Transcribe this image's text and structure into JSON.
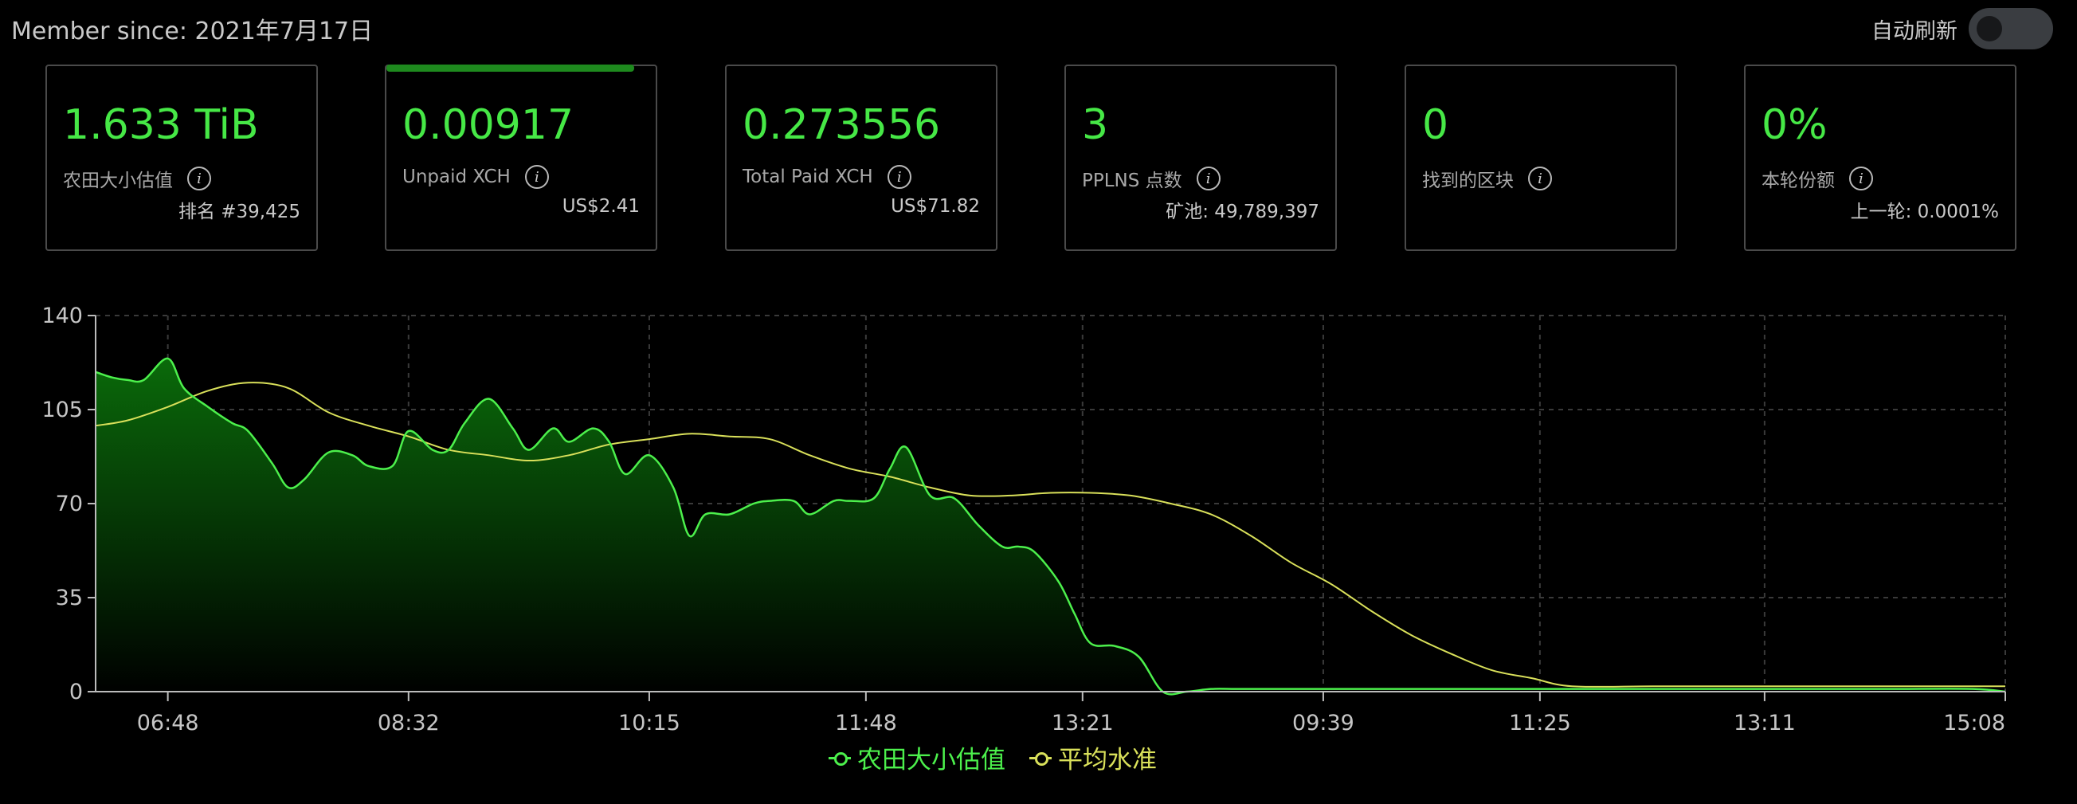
{
  "header": {
    "member_since": "Member since: 2021年7月17日",
    "auto_refresh_label": "自动刷新",
    "auto_refresh_on": false
  },
  "cards": [
    {
      "value": "1.633 TiB",
      "label": "农田大小估值",
      "sub": "排名 #39,425"
    },
    {
      "value": "0.00917",
      "label": "Unpaid XCH",
      "sub": "US$2.41",
      "progress": 0.92
    },
    {
      "value": "0.273556",
      "label": "Total Paid XCH",
      "sub": "US$71.82"
    },
    {
      "value": "3",
      "label": "PPLNS 点数",
      "sub": "矿池: 49,789,397"
    },
    {
      "value": "0",
      "label": "找到的区块",
      "sub": ""
    },
    {
      "value": "0%",
      "label": "本轮份额",
      "sub": "上一轮: 0.0001%"
    }
  ],
  "icons": {
    "info": "info-icon"
  },
  "colors": {
    "accent": "#46e846",
    "farm": "#4cf04c",
    "avg": "#d9e05a",
    "fill_top": "#0a6a0a"
  },
  "chart_data": {
    "type": "area",
    "ylim": [
      0,
      140
    ],
    "yticks": [
      0,
      35,
      70,
      105,
      140
    ],
    "xticks": [
      {
        "label": "06:48",
        "x": 0.5
      },
      {
        "label": "08:32",
        "x": 3.5
      },
      {
        "label": "10:15",
        "x": 6.5
      },
      {
        "label": "11:48",
        "x": 9.2
      },
      {
        "label": "13:21",
        "x": 11.9
      },
      {
        "label": "09:39",
        "x": 14.9
      },
      {
        "label": "11:25",
        "x": 17.6
      },
      {
        "label": "13:11",
        "x": 20.4
      },
      {
        "label": "15:08",
        "x": 23.4
      }
    ],
    "xrange": [
      -0.4,
      23.4
    ],
    "series": [
      {
        "name": "农田大小估值",
        "x": [
          -0.4,
          -0.2,
          0.0,
          0.2,
          0.5,
          0.7,
          1.0,
          1.3,
          1.5,
          1.8,
          2.0,
          2.2,
          2.5,
          2.8,
          3.0,
          3.3,
          3.5,
          3.8,
          4.0,
          4.2,
          4.5,
          4.8,
          5.0,
          5.3,
          5.5,
          5.8,
          6.0,
          6.2,
          6.5,
          6.8,
          7.0,
          7.2,
          7.5,
          7.8,
          8.0,
          8.3,
          8.5,
          8.8,
          9.0,
          9.3,
          9.5,
          9.7,
          10.0,
          10.3,
          10.6,
          10.9,
          11.1,
          11.3,
          11.6,
          11.8,
          12.0,
          12.3,
          12.6,
          12.9,
          13.2,
          13.5,
          13.8,
          14.1,
          14.4,
          14.7,
          15.0,
          15.3,
          15.6,
          16.0,
          17.0,
          18.0,
          19.0,
          20.0,
          21.0,
          22.0,
          23.0,
          23.4
        ],
        "values": [
          119,
          117,
          116,
          116,
          124,
          113,
          106,
          100,
          97,
          85,
          76,
          79,
          89,
          88,
          84,
          84,
          97,
          90,
          90,
          100,
          109,
          98,
          90,
          98,
          93,
          98,
          93,
          81,
          88,
          76,
          58,
          66,
          66,
          70,
          71,
          71,
          66,
          71,
          71,
          72,
          83,
          91,
          73,
          72,
          62,
          54,
          54,
          52,
          41,
          29,
          18,
          17,
          13,
          0,
          0,
          1,
          1,
          1,
          1,
          1,
          1,
          1,
          1,
          1,
          1,
          1,
          1,
          1,
          1,
          1,
          1,
          0
        ]
      },
      {
        "name": "平均水准",
        "x": [
          -0.4,
          0.0,
          0.5,
          1.0,
          1.5,
          2.0,
          2.5,
          3.0,
          3.5,
          4.0,
          4.5,
          5.0,
          5.5,
          6.0,
          6.5,
          7.0,
          7.5,
          8.0,
          8.5,
          9.0,
          9.5,
          10.0,
          10.5,
          11.0,
          11.5,
          12.0,
          12.5,
          13.0,
          13.5,
          14.0,
          14.5,
          15.0,
          15.5,
          16.0,
          16.5,
          17.0,
          17.5,
          18.0,
          19.0,
          20.0,
          21.0,
          22.0,
          23.0,
          23.4
        ],
        "values": [
          99,
          101,
          106,
          112,
          115,
          113,
          104,
          99,
          95,
          90,
          88,
          86,
          88,
          92,
          94,
          96,
          95,
          94,
          88,
          83,
          80,
          76,
          73,
          73,
          74,
          74,
          73,
          70,
          66,
          58,
          48,
          40,
          30,
          21,
          14,
          8,
          5,
          2,
          2,
          2,
          2,
          2,
          2,
          2
        ]
      }
    ]
  }
}
